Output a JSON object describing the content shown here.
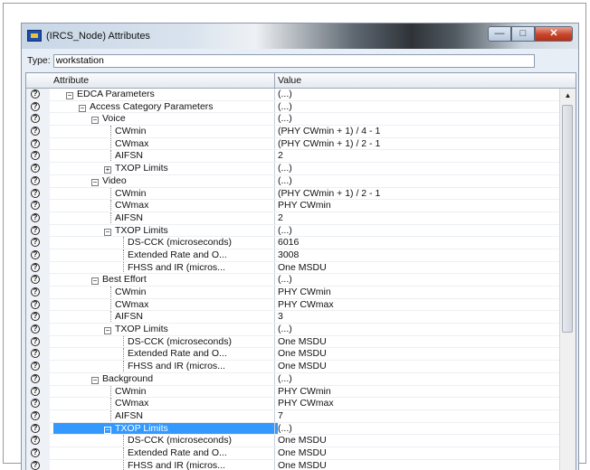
{
  "window": {
    "title": "(IRCS_Node) Attributes",
    "buttons": {
      "min": "—",
      "max": "□",
      "close": "✕"
    }
  },
  "type_field": {
    "label": "Type:",
    "value": "workstation"
  },
  "grid": {
    "headers": {
      "attribute": "Attribute",
      "value": "Value"
    },
    "rows": [
      {
        "label": "EDCA Parameters",
        "value": "(...)",
        "depth": 0,
        "toggle": "minus"
      },
      {
        "label": "Access Category Parameters",
        "value": "(...)",
        "depth": 1,
        "toggle": "minus"
      },
      {
        "label": "Voice",
        "value": "(...)",
        "depth": 2,
        "toggle": "minus"
      },
      {
        "label": "CWmin",
        "value": "(PHY CWmin + 1) / 4 - 1",
        "depth": 3,
        "toggle": ""
      },
      {
        "label": "CWmax",
        "value": "(PHY CWmin + 1) / 2 - 1",
        "depth": 3,
        "toggle": ""
      },
      {
        "label": "AIFSN",
        "value": "2",
        "depth": 3,
        "toggle": ""
      },
      {
        "label": "TXOP Limits",
        "value": "(...)",
        "depth": 3,
        "toggle": "plus"
      },
      {
        "label": "Video",
        "value": "(...)",
        "depth": 2,
        "toggle": "minus"
      },
      {
        "label": "CWmin",
        "value": "(PHY CWmin + 1) / 2 - 1",
        "depth": 3,
        "toggle": ""
      },
      {
        "label": "CWmax",
        "value": "PHY CWmin",
        "depth": 3,
        "toggle": ""
      },
      {
        "label": "AIFSN",
        "value": "2",
        "depth": 3,
        "toggle": ""
      },
      {
        "label": "TXOP Limits",
        "value": "(...)",
        "depth": 3,
        "toggle": "minus"
      },
      {
        "label": "DS-CCK (microseconds)",
        "value": "6016",
        "depth": 4,
        "toggle": ""
      },
      {
        "label": "Extended Rate and O...",
        "value": "3008",
        "depth": 4,
        "toggle": ""
      },
      {
        "label": "FHSS and IR (micros...",
        "value": "One MSDU",
        "depth": 4,
        "toggle": ""
      },
      {
        "label": "Best Effort",
        "value": "(...)",
        "depth": 2,
        "toggle": "minus"
      },
      {
        "label": "CWmin",
        "value": "PHY CWmin",
        "depth": 3,
        "toggle": ""
      },
      {
        "label": "CWmax",
        "value": "PHY CWmax",
        "depth": 3,
        "toggle": ""
      },
      {
        "label": "AIFSN",
        "value": "3",
        "depth": 3,
        "toggle": ""
      },
      {
        "label": "TXOP Limits",
        "value": "(...)",
        "depth": 3,
        "toggle": "minus"
      },
      {
        "label": "DS-CCK (microseconds)",
        "value": "One MSDU",
        "depth": 4,
        "toggle": ""
      },
      {
        "label": "Extended Rate and O...",
        "value": "One MSDU",
        "depth": 4,
        "toggle": ""
      },
      {
        "label": "FHSS and IR (micros...",
        "value": "One MSDU",
        "depth": 4,
        "toggle": ""
      },
      {
        "label": "Background",
        "value": "(...)",
        "depth": 2,
        "toggle": "minus"
      },
      {
        "label": "CWmin",
        "value": "PHY CWmin",
        "depth": 3,
        "toggle": ""
      },
      {
        "label": "CWmax",
        "value": "PHY CWmax",
        "depth": 3,
        "toggle": ""
      },
      {
        "label": "AIFSN",
        "value": "7",
        "depth": 3,
        "toggle": ""
      },
      {
        "label": "TXOP Limits",
        "value": "(...)",
        "depth": 3,
        "toggle": "minus",
        "selected": true
      },
      {
        "label": "DS-CCK (microseconds)",
        "value": "One MSDU",
        "depth": 4,
        "toggle": ""
      },
      {
        "label": "Extended Rate and O...",
        "value": "One MSDU",
        "depth": 4,
        "toggle": ""
      },
      {
        "label": "FHSS and IR (micros...",
        "value": "One MSDU",
        "depth": 4,
        "toggle": ""
      }
    ]
  },
  "icons": {
    "help": "?",
    "toggle_minus": "−",
    "toggle_plus": "+"
  },
  "colors": {
    "selection": "#3399ff",
    "titlebar_close": "#c8442a"
  }
}
